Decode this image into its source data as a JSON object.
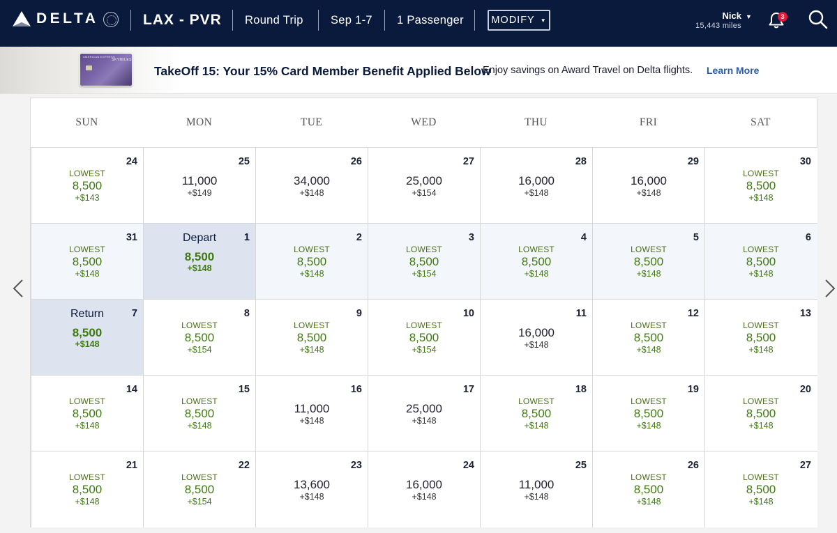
{
  "header": {
    "logo_text": "DELTA",
    "route": "LAX - PVR",
    "trip_type": "Round Trip",
    "dates": "Sep 1-7",
    "passengers": "1 Passenger",
    "modify_label": "MODIFY",
    "user_name": "Nick",
    "user_miles": "15,443 miles",
    "notification_count": "3"
  },
  "promo": {
    "card_issuer": "AMERICAN EXPRESS",
    "card_brand": "SKYMILES",
    "title": "TakeOff 15: Your 15% Card Member Benefit Applied Below",
    "text": "Enjoy savings on Award Travel on Delta flights.",
    "link": "Learn More"
  },
  "calendar": {
    "weekdays": [
      "SUN",
      "MON",
      "TUE",
      "WED",
      "THU",
      "FRI",
      "SAT"
    ],
    "lowest_label": "LOWEST",
    "weeks": [
      [
        {
          "date": "24",
          "lowest": true,
          "miles": "8,500",
          "tax": "+$143"
        },
        {
          "date": "25",
          "lowest": false,
          "miles": "11,000",
          "tax": "+$149"
        },
        {
          "date": "26",
          "lowest": false,
          "miles": "34,000",
          "tax": "+$148"
        },
        {
          "date": "27",
          "lowest": false,
          "miles": "25,000",
          "tax": "+$154"
        },
        {
          "date": "28",
          "lowest": false,
          "miles": "16,000",
          "tax": "+$148"
        },
        {
          "date": "29",
          "lowest": false,
          "miles": "16,000",
          "tax": "+$148"
        },
        {
          "date": "30",
          "lowest": true,
          "miles": "8,500",
          "tax": "+$148"
        }
      ],
      [
        {
          "date": "31",
          "lowest": true,
          "miles": "8,500",
          "tax": "+$148"
        },
        {
          "date": "1",
          "selected": "Depart",
          "miles": "8,500",
          "tax": "+$148"
        },
        {
          "date": "2",
          "lowest": true,
          "miles": "8,500",
          "tax": "+$148"
        },
        {
          "date": "3",
          "lowest": true,
          "miles": "8,500",
          "tax": "+$154"
        },
        {
          "date": "4",
          "lowest": true,
          "miles": "8,500",
          "tax": "+$148"
        },
        {
          "date": "5",
          "lowest": true,
          "miles": "8,500",
          "tax": "+$148"
        },
        {
          "date": "6",
          "lowest": true,
          "miles": "8,500",
          "tax": "+$148"
        }
      ],
      [
        {
          "date": "7",
          "selected": "Return",
          "miles": "8,500",
          "tax": "+$148"
        },
        {
          "date": "8",
          "lowest": true,
          "miles": "8,500",
          "tax": "+$154"
        },
        {
          "date": "9",
          "lowest": true,
          "miles": "8,500",
          "tax": "+$148"
        },
        {
          "date": "10",
          "lowest": true,
          "miles": "8,500",
          "tax": "+$154"
        },
        {
          "date": "11",
          "lowest": false,
          "miles": "16,000",
          "tax": "+$148"
        },
        {
          "date": "12",
          "lowest": true,
          "miles": "8,500",
          "tax": "+$148"
        },
        {
          "date": "13",
          "lowest": true,
          "miles": "8,500",
          "tax": "+$148"
        }
      ],
      [
        {
          "date": "14",
          "lowest": true,
          "miles": "8,500",
          "tax": "+$148"
        },
        {
          "date": "15",
          "lowest": true,
          "miles": "8,500",
          "tax": "+$148"
        },
        {
          "date": "16",
          "lowest": false,
          "miles": "11,000",
          "tax": "+$148"
        },
        {
          "date": "17",
          "lowest": false,
          "miles": "25,000",
          "tax": "+$148"
        },
        {
          "date": "18",
          "lowest": true,
          "miles": "8,500",
          "tax": "+$148"
        },
        {
          "date": "19",
          "lowest": true,
          "miles": "8,500",
          "tax": "+$148"
        },
        {
          "date": "20",
          "lowest": true,
          "miles": "8,500",
          "tax": "+$148"
        }
      ],
      [
        {
          "date": "21",
          "lowest": true,
          "miles": "8,500",
          "tax": "+$148"
        },
        {
          "date": "22",
          "lowest": true,
          "miles": "8,500",
          "tax": "+$154"
        },
        {
          "date": "23",
          "lowest": false,
          "miles": "13,600",
          "tax": "+$148"
        },
        {
          "date": "24",
          "lowest": false,
          "miles": "16,000",
          "tax": "+$148"
        },
        {
          "date": "25",
          "lowest": false,
          "miles": "11,000",
          "tax": "+$148"
        },
        {
          "date": "26",
          "lowest": true,
          "miles": "8,500",
          "tax": "+$148"
        },
        {
          "date": "27",
          "lowest": true,
          "miles": "8,500",
          "tax": "+$148"
        }
      ]
    ]
  },
  "icons": {
    "logo": "delta-widget-icon",
    "bell": "bell-icon",
    "search": "search-icon",
    "prev": "chevron-left-icon",
    "next": "chevron-right-icon"
  },
  "colors": {
    "header_bg": "#0a1a3d",
    "fare_green": "#3f7a10",
    "selected_bg": "#dde4ef",
    "badge_red": "#e31837",
    "link_blue": "#2b5aa8"
  }
}
